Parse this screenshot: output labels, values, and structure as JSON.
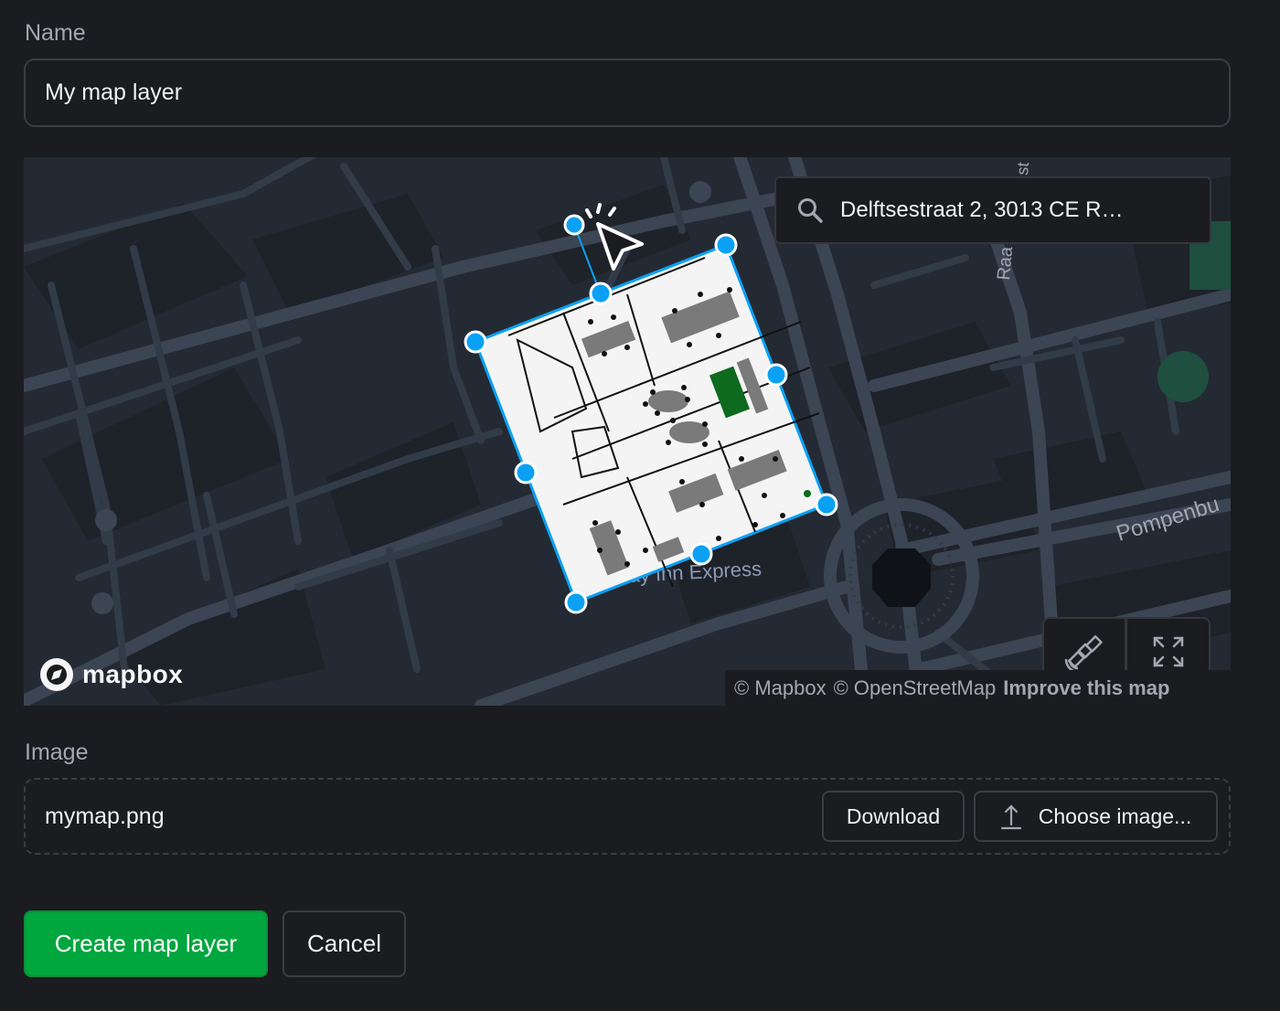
{
  "name_section": {
    "label": "Name",
    "value": "My map layer"
  },
  "map": {
    "search_value": "Delftsestraat 2, 3013 CE R…",
    "street_labels": {
      "raa": "Raa",
      "st": "st",
      "pompenbu": "Pompenbu",
      "poi": "ay Inn Express"
    },
    "logo_text": "mapbox",
    "attribution": {
      "mapbox": "© Mapbox",
      "osm": "© OpenStreetMap",
      "improve": "Improve this map"
    },
    "controls": {
      "satellite_icon": "satellite-icon",
      "fullscreen_icon": "fullscreen-icon"
    }
  },
  "image_section": {
    "label": "Image",
    "filename": "mymap.png",
    "download_label": "Download",
    "choose_label": "Choose image..."
  },
  "actions": {
    "create_label": "Create map layer",
    "cancel_label": "Cancel"
  },
  "colors": {
    "accent": "#00a63e",
    "handle": "#0aa1f5",
    "background": "#1b1c1f"
  }
}
